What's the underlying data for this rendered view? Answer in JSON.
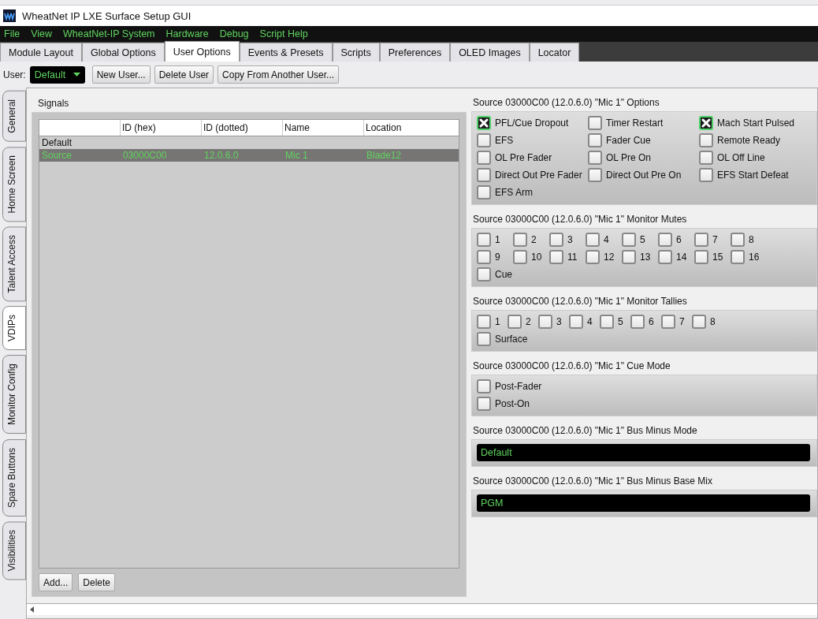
{
  "window": {
    "title": "WheatNet IP LXE Surface Setup GUI"
  },
  "menu": [
    "File",
    "View",
    "WheatNet-IP System",
    "Hardware",
    "Debug",
    "Script Help"
  ],
  "tabs": [
    {
      "label": "Module Layout",
      "selected": false
    },
    {
      "label": "Global Options",
      "selected": false
    },
    {
      "label": "User Options",
      "selected": true
    },
    {
      "label": "Events & Presets",
      "selected": false
    },
    {
      "label": "Scripts",
      "selected": false
    },
    {
      "label": "Preferences",
      "selected": false
    },
    {
      "label": "OLED Images",
      "selected": false
    },
    {
      "label": "Locator",
      "selected": false
    }
  ],
  "user_bar": {
    "label": "User:",
    "value": "Default",
    "buttons": [
      "New User...",
      "Delete User",
      "Copy From Another User..."
    ]
  },
  "side_tabs": [
    {
      "label": "General",
      "selected": false
    },
    {
      "label": "Home Screen",
      "selected": false
    },
    {
      "label": "Talent Access",
      "selected": false
    },
    {
      "label": "VDIPs",
      "selected": true
    },
    {
      "label": "Monitor Config",
      "selected": false
    },
    {
      "label": "Spare Buttons",
      "selected": false
    },
    {
      "label": "Visibilities",
      "selected": false
    }
  ],
  "signals": {
    "title": "Signals",
    "columns": [
      "",
      "ID (hex)",
      "ID (dotted)",
      "Name",
      "Location"
    ],
    "rows": [
      {
        "kind": "group",
        "cells": [
          "Default"
        ],
        "selected": false
      },
      {
        "kind": "signal",
        "cells": [
          "Source",
          "03000C00",
          "12.0.6.0",
          "Mic 1",
          "Blade12"
        ],
        "selected": true
      }
    ],
    "buttons": [
      "Add...",
      "Delete"
    ]
  },
  "groups": [
    {
      "title": "Source 03000C00 (12.0.6.0) \"Mic 1\" Options",
      "kind": "options",
      "rows": [
        [
          {
            "label": "PFL/Cue Dropout",
            "checked": true
          },
          {
            "label": "Timer Restart",
            "checked": false
          },
          {
            "label": "Mach Start Pulsed",
            "checked": true
          }
        ],
        [
          {
            "label": "EFS",
            "checked": false
          },
          {
            "label": "Fader Cue",
            "checked": false
          },
          {
            "label": "Remote Ready",
            "checked": false
          }
        ],
        [
          {
            "label": "OL Pre Fader",
            "checked": false
          },
          {
            "label": "OL Pre On",
            "checked": false
          },
          {
            "label": "OL Off Line",
            "checked": false
          }
        ],
        [
          {
            "label": "Direct Out Pre Fader",
            "checked": false
          },
          {
            "label": "Direct Out Pre On",
            "checked": false
          },
          {
            "label": "EFS Start Defeat",
            "checked": false
          }
        ],
        [
          {
            "label": "EFS Arm",
            "checked": false
          }
        ]
      ]
    },
    {
      "title": "Source 03000C00 (12.0.6.0) \"Mic 1\" Monitor Mutes",
      "kind": "mutes",
      "rows": [
        [
          {
            "label": "1",
            "checked": false
          },
          {
            "label": "2",
            "checked": false
          },
          {
            "label": "3",
            "checked": false
          },
          {
            "label": "4",
            "checked": false
          },
          {
            "label": "5",
            "checked": false
          },
          {
            "label": "6",
            "checked": false
          },
          {
            "label": "7",
            "checked": false
          },
          {
            "label": "8",
            "checked": false
          }
        ],
        [
          {
            "label": "9",
            "checked": false
          },
          {
            "label": "10",
            "checked": false
          },
          {
            "label": "11",
            "checked": false
          },
          {
            "label": "12",
            "checked": false
          },
          {
            "label": "13",
            "checked": false
          },
          {
            "label": "14",
            "checked": false
          },
          {
            "label": "15",
            "checked": false
          },
          {
            "label": "16",
            "checked": false
          }
        ],
        [
          {
            "label": "Cue",
            "checked": false
          }
        ]
      ]
    },
    {
      "title": "Source 03000C00 (12.0.6.0) \"Mic 1\" Monitor Tallies",
      "kind": "tallies",
      "rows": [
        [
          {
            "label": "1",
            "checked": false
          },
          {
            "label": "2",
            "checked": false
          },
          {
            "label": "3",
            "checked": false
          },
          {
            "label": "4",
            "checked": false
          },
          {
            "label": "5",
            "checked": false
          },
          {
            "label": "6",
            "checked": false
          },
          {
            "label": "7",
            "checked": false
          },
          {
            "label": "8",
            "checked": false
          }
        ],
        [
          {
            "label": "Surface",
            "checked": false
          }
        ]
      ]
    },
    {
      "title": "Source 03000C00 (12.0.6.0) \"Mic 1\" Cue Mode",
      "kind": "modes",
      "rows": [
        [
          {
            "label": "Post-Fader",
            "checked": false
          }
        ],
        [
          {
            "label": "Post-On",
            "checked": false
          }
        ]
      ]
    },
    {
      "title": "Source 03000C00 (12.0.6.0) \"Mic 1\" Bus Minus Mode",
      "kind": "select",
      "value": "Default"
    },
    {
      "title": "Source 03000C00 (12.0.6.0) \"Mic 1\" Bus Minus Base Mix",
      "kind": "select",
      "value": "PGM"
    }
  ]
}
